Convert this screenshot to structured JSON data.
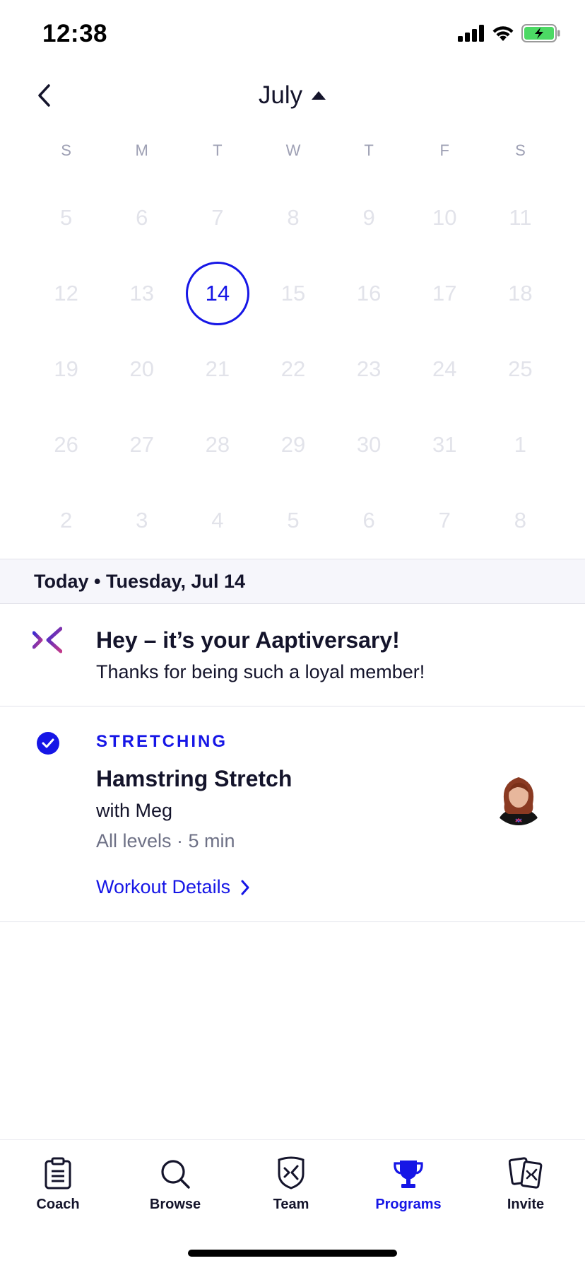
{
  "status_bar": {
    "time": "12:38",
    "battery_color": "#4cd964"
  },
  "calendar": {
    "month": "July",
    "weekdays": [
      "S",
      "M",
      "T",
      "W",
      "T",
      "F",
      "S"
    ],
    "weeks": [
      [
        "5",
        "6",
        "7",
        "8",
        "9",
        "10",
        "11"
      ],
      [
        "12",
        "13",
        "14",
        "15",
        "16",
        "17",
        "18"
      ],
      [
        "19",
        "20",
        "21",
        "22",
        "23",
        "24",
        "25"
      ],
      [
        "26",
        "27",
        "28",
        "29",
        "30",
        "31",
        "1"
      ],
      [
        "2",
        "3",
        "4",
        "5",
        "6",
        "7",
        "8"
      ]
    ],
    "selected_day": "14"
  },
  "today_bar": {
    "text": "Today • Tuesday, Jul 14"
  },
  "anniversary": {
    "title": "Hey – it’s your Aaptiversary!",
    "subtitle": "Thanks for being such a loyal member!"
  },
  "workout": {
    "category": "STRETCHING",
    "title": "Hamstring Stretch",
    "trainer": "with Meg",
    "meta": "All levels · 5 min",
    "details_link": "Workout Details",
    "completed": true
  },
  "tabs": [
    {
      "label": "Coach",
      "icon": "clipboard-icon",
      "active": false
    },
    {
      "label": "Browse",
      "icon": "search-icon",
      "active": false
    },
    {
      "label": "Team",
      "icon": "shield-icon",
      "active": false
    },
    {
      "label": "Programs",
      "icon": "trophy-icon",
      "active": true
    },
    {
      "label": "Invite",
      "icon": "cards-icon",
      "active": false
    }
  ],
  "colors": {
    "accent": "#1616e6",
    "text": "#14142b",
    "muted": "#6e7186",
    "disabled": "#e2e3ea"
  }
}
